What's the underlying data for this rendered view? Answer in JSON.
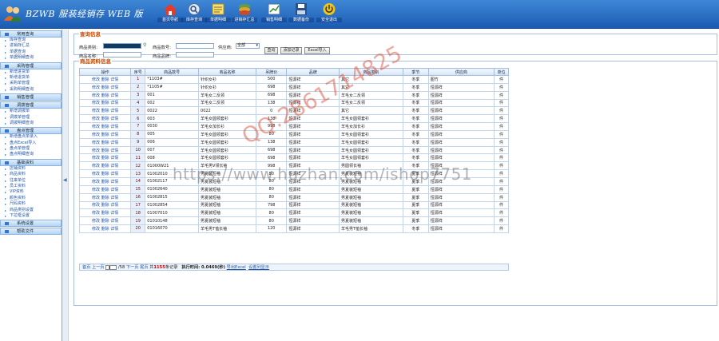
{
  "app": {
    "title": "BZWB 服装经销存 WEB 版"
  },
  "toolbar": [
    {
      "label": "首页导航",
      "icon": "home-icon"
    },
    {
      "label": "库存查询",
      "icon": "search-icon"
    },
    {
      "label": "单据明细",
      "icon": "notes-icon"
    },
    {
      "label": "进销存汇总",
      "icon": "stack-icon"
    },
    {
      "label": "销售明细",
      "icon": "sales-icon"
    },
    {
      "label": "数据备份",
      "icon": "save-icon"
    },
    {
      "label": "安全退出",
      "icon": "power-icon"
    }
  ],
  "sidebar": [
    {
      "group": "常用查询",
      "items": [
        "库存查询",
        "进销存汇总",
        "单据查询",
        "单据明细查询"
      ]
    },
    {
      "group": "采购管理",
      "items": [
        "新增进货单",
        "新增退货单",
        "采购单管理",
        "采购明细查询"
      ]
    },
    {
      "group": "销售管理",
      "items": []
    },
    {
      "group": "调拨管理",
      "items": [
        "新增调拨单",
        "调拨单管理",
        "调拨明细查询"
      ]
    },
    {
      "group": "盘点管理",
      "items": [
        "新增盘点单录入",
        "盘点Excel导入",
        "盘点单管理",
        "盘点明细查询"
      ]
    },
    {
      "group": "基础资料",
      "items": [
        "店铺资料",
        "商品资料",
        "往来单位",
        "员工资料",
        "VIP资料",
        "颜色资料",
        "尺码资料",
        "商品类别设置",
        "下拉框设置"
      ]
    },
    {
      "group": "系统设置",
      "items": []
    },
    {
      "group": "帮助文件",
      "items": []
    }
  ],
  "query": {
    "legend": "查询信息",
    "code_label": "商品类别:",
    "goods_no_label": "商品款号:",
    "supplier_label": "供应商:",
    "supplier_value": "全部",
    "name_label": "商品名称:",
    "brand_label": "商品品牌:",
    "btn_query": "查询",
    "btn_add": "添加记录",
    "btn_excel": "Excel导入"
  },
  "results": {
    "legend": "商品资料信息",
    "columns": [
      "操作",
      "序号",
      "商品款号",
      "商品名称",
      "吊牌价",
      "品牌",
      "商品类别",
      "季节",
      "供应商",
      "单位"
    ],
    "ops": "修改 删除 详情",
    "rows": [
      [
        "1",
        "*1103#",
        "针织女衫",
        "500",
        "恒源祥",
        "其它",
        "冬季",
        "图竹",
        "件"
      ],
      [
        "2",
        "*1105#",
        "针织女衫",
        "698",
        "恒源祥",
        "其它",
        "冬季",
        "恒源祥",
        "件"
      ],
      [
        "3",
        "001",
        "羊毛女二反领",
        "698",
        "恒源祥",
        "羊毛女二反领",
        "冬季",
        "恒源祥",
        "件"
      ],
      [
        "4",
        "002",
        "羊毛女二反领",
        "138",
        "恒源祥",
        "羊毛女二反领",
        "冬季",
        "恒源祥",
        "件"
      ],
      [
        "5",
        "0022",
        "0022",
        "0",
        "恒源祥",
        "其它",
        "冬季",
        "恒源祥",
        "件"
      ],
      [
        "6",
        "003",
        "羊毛女圆领套衫",
        "138",
        "恒源祥",
        "羊毛女圆领套衫",
        "冬季",
        "恒源祥",
        "件"
      ],
      [
        "7",
        "0030",
        "羊毛女加长衫",
        "998",
        "恒源祥",
        "羊毛女加长衫",
        "冬季",
        "恒源祥",
        "件"
      ],
      [
        "8",
        "005",
        "羊毛女圆领套衫",
        "80",
        "恒源祥",
        "羊毛女圆领套衫",
        "冬季",
        "恒源祥",
        "件"
      ],
      [
        "9",
        "006",
        "羊毛女圆领套衫",
        "138",
        "恒源祥",
        "羊毛女圆领套衫",
        "冬季",
        "恒源祥",
        "件"
      ],
      [
        "10",
        "007",
        "羊毛女圆领套衫",
        "698",
        "恒源祥",
        "羊毛女圆领套衫",
        "冬季",
        "恒源祥",
        "件"
      ],
      [
        "11",
        "008",
        "羊毛女圆领套衫",
        "698",
        "恒源祥",
        "羊毛女圆领套衫",
        "冬季",
        "恒源祥",
        "件"
      ],
      [
        "12",
        "01000W21",
        "羊毛男V领长袖",
        "998",
        "恒源祥",
        "男圆领长袖",
        "冬季",
        "恒源祥",
        "件"
      ],
      [
        "13",
        "01002010",
        "男夏装短袖",
        "80",
        "恒源祥",
        "男夏装短袖",
        "夏季",
        "恒源祥",
        "件"
      ],
      [
        "14",
        "01002117",
        "男夏装短袖",
        "80",
        "恒源祥",
        "男夏装短袖",
        "夏季",
        "恒源祥",
        "件"
      ],
      [
        "15",
        "01002640",
        "男夏装短袖",
        "80",
        "恒源祥",
        "男夏装短袖",
        "夏季",
        "恒源祥",
        "件"
      ],
      [
        "16",
        "01002815",
        "男夏装短袖",
        "80",
        "恒源祥",
        "男夏装短袖",
        "夏季",
        "恒源祥",
        "件"
      ],
      [
        "17",
        "01002854",
        "男夏装短袖",
        "798",
        "恒源祥",
        "男夏装短袖",
        "夏季",
        "恒源祥",
        "件"
      ],
      [
        "18",
        "01007010",
        "男夏装短袖",
        "80",
        "恒源祥",
        "男夏装短袖",
        "夏季",
        "恒源祥",
        "件"
      ],
      [
        "19",
        "01010148",
        "男夏装短袖",
        "80",
        "恒源祥",
        "男夏装短袖",
        "夏季",
        "恒源祥",
        "件"
      ],
      [
        "20",
        "01016070",
        "羊毛男T恤长袖",
        "120",
        "恒源祥",
        "羊毛男T恤长袖",
        "冬季",
        "恒源祥",
        "件"
      ]
    ]
  },
  "pager": {
    "first_prev": "首页 上一页",
    "page_value": "1",
    "page_total": "/58",
    "next": "下一页",
    "last": "尾页",
    "total_pre": "共",
    "total_count": "1155",
    "total_post": "条记录",
    "exec": "执行时间: 0.0469(秒)",
    "export": "导出Excel",
    "columns": "设置列显示"
  },
  "watermark": {
    "url": "https://www.huzhan.com/ishop7751",
    "qq": "QQ:2861714825"
  }
}
